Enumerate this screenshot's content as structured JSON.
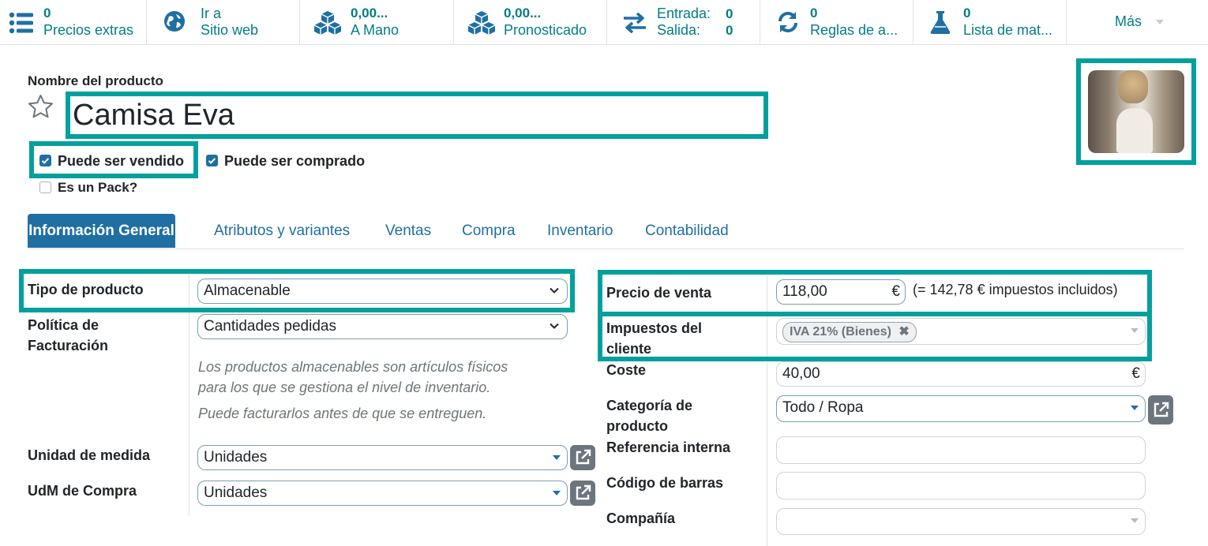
{
  "smart_buttons": [
    {
      "value": "0",
      "label": "Precios extras",
      "icon": "list-icon"
    },
    {
      "value": "Ir a",
      "label": "Sitio web",
      "icon": "globe-icon"
    },
    {
      "value": "0,00...",
      "label": "A Mano",
      "icon": "cubes-icon"
    },
    {
      "value": "0,00...",
      "label": "Pronosticado",
      "icon": "cubes-icon"
    },
    {
      "in_label": "Entrada:",
      "in_value": "0",
      "out_label": "Salida:",
      "out_value": "0",
      "icon": "exchange-icon"
    },
    {
      "value": "0",
      "label": "Reglas de a...",
      "icon": "refresh-icon"
    },
    {
      "value": "0",
      "label": "Lista de mat...",
      "icon": "flask-icon"
    }
  ],
  "more_label": "Más",
  "product": {
    "name_label": "Nombre del producto",
    "name": "Camisa Eva",
    "can_be_sold": "Puede ser vendido",
    "can_be_purchased": "Puede ser comprado",
    "is_pack": "Es un Pack?"
  },
  "tabs": [
    "Información General",
    "Atributos y variantes",
    "Ventas",
    "Compra",
    "Inventario",
    "Contabilidad"
  ],
  "left": {
    "product_type_label": "Tipo de producto",
    "product_type": "Almacenable",
    "invoice_policy_label_1": "Política de",
    "invoice_policy_label_2": "Facturación",
    "invoice_policy": "Cantidades pedidas",
    "help_1": "Los productos almacenables son artículos físicos",
    "help_2": "para los que se gestiona el nivel de inventario.",
    "help_3": "Puede facturarlos antes de que se entreguen.",
    "uom_label": "Unidad de medida",
    "uom": "Unidades",
    "po_uom_label": "UdM de Compra",
    "po_uom": "Unidades"
  },
  "right": {
    "sale_price_label": "Precio de venta",
    "sale_price": "118,00",
    "currency": "€",
    "tax_included": "(= 142,78 € impuestos incluidos)",
    "customer_taxes_label_1": "Impuestos del",
    "customer_taxes_label_2": "cliente",
    "tax_tag": "IVA 21% (Bienes)",
    "cost_label": "Coste",
    "cost": "40,00",
    "category_label_1": "Categoría de",
    "category_label_2": "producto",
    "category": "Todo / Ropa",
    "internal_ref_label": "Referencia interna",
    "barcode_label": "Código de barras",
    "company_label": "Compañía"
  },
  "colors": {
    "accent": "#1f6fa3",
    "smart_text": "#017e84",
    "highlight": "#00a09d"
  }
}
